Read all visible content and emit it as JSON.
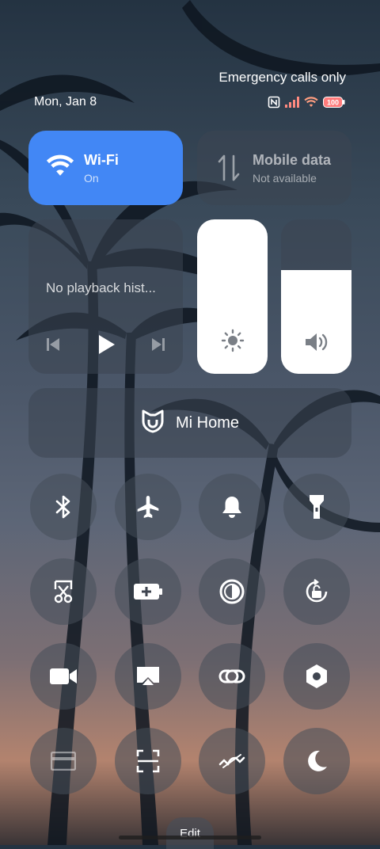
{
  "status": {
    "date": "Mon, Jan 8",
    "network_text": "Emergency calls only",
    "battery": "100"
  },
  "tiles": {
    "wifi": {
      "title": "Wi-Fi",
      "status": "On"
    },
    "mobile": {
      "title": "Mobile data",
      "status": "Not available"
    }
  },
  "media": {
    "title": "No playback hist..."
  },
  "sliders": {
    "brightness_level": 1.0,
    "volume_level": 0.67
  },
  "mi_home": {
    "label": "Mi Home"
  },
  "edit_label": "Edit",
  "colors": {
    "accent": "#4287f5"
  }
}
